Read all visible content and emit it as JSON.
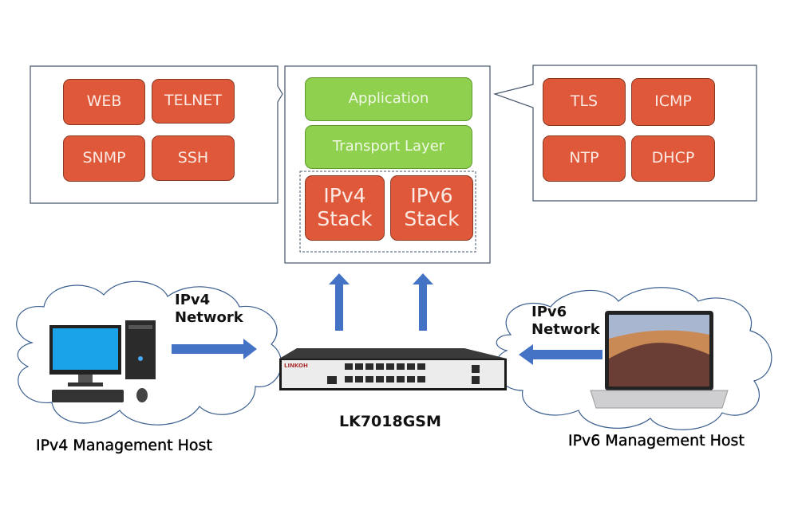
{
  "left_callout": {
    "items": [
      "WEB",
      "TELNET",
      "SNMP",
      "SSH"
    ]
  },
  "center_stack": {
    "application": "Application",
    "transport": "Transport Layer",
    "ipv4_stack": "IPv4 Stack",
    "ipv6_stack": "IPv6 Stack"
  },
  "right_callout": {
    "items": [
      "TLS",
      "ICMP",
      "NTP",
      "DHCP"
    ]
  },
  "left_network": {
    "label": "IPv4 Network",
    "host_label": "IPv4 Management Host"
  },
  "right_network": {
    "label": "IPv6 Network",
    "host_label": "IPv6 Management Host"
  },
  "switch": {
    "model": "LK7018GSM",
    "brand": "LINKOH"
  },
  "colors": {
    "service_box": "#e0583a",
    "layer_box": "#8fd14f",
    "arrow": "#4472c4",
    "callout_border": "#44546a"
  }
}
